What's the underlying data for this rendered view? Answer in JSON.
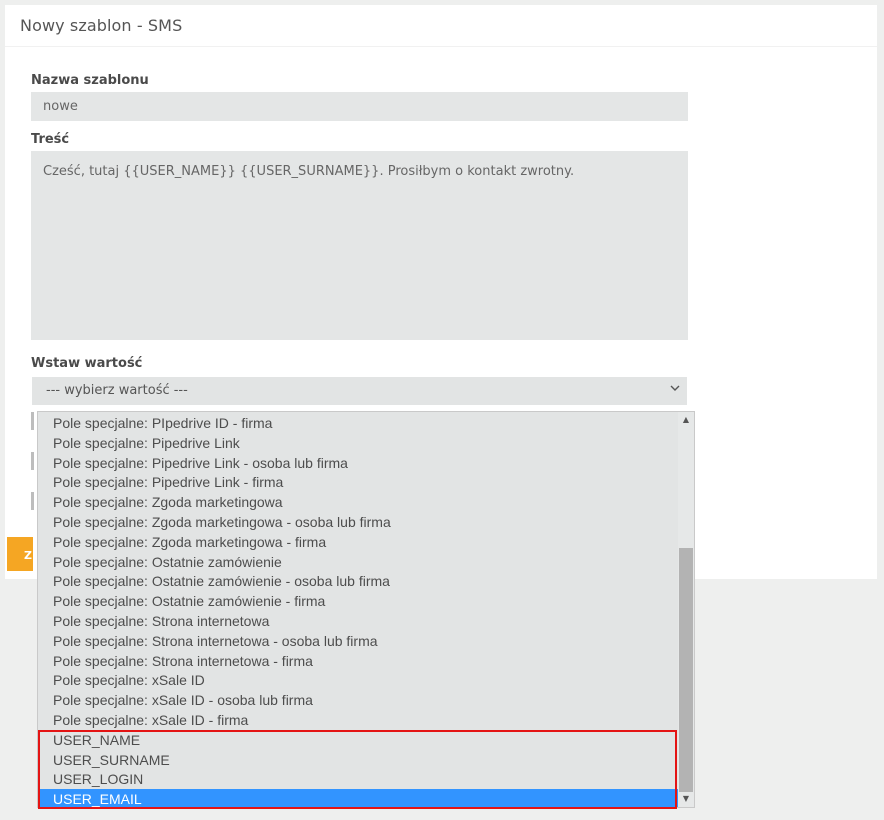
{
  "card": {
    "title": "Nowy szablon - SMS"
  },
  "form": {
    "name_label": "Nazwa szablonu",
    "name_value": "nowe",
    "content_label": "Treść",
    "content_value": "Cześć, tutaj {{USER_NAME}} {{USER_SURNAME}}. Prosiłbym o kontakt zwrotny.",
    "insert_label": "Wstaw wartość",
    "insert_selected": "--- wybierz wartość ---",
    "save_label_fragment": "Z"
  },
  "dropdown": {
    "options": [
      "Pole specjalne: PIpedrive ID - firma",
      "Pole specjalne: Pipedrive Link",
      "Pole specjalne: Pipedrive Link - osoba lub firma",
      "Pole specjalne: Pipedrive Link - firma",
      "Pole specjalne: Zgoda marketingowa",
      "Pole specjalne: Zgoda marketingowa - osoba lub firma",
      "Pole specjalne: Zgoda marketingowa - firma",
      "Pole specjalne: Ostatnie zamówienie",
      "Pole specjalne: Ostatnie zamówienie - osoba lub firma",
      "Pole specjalne: Ostatnie zamówienie - firma",
      "Pole specjalne: Strona internetowa",
      "Pole specjalne: Strona internetowa - osoba lub firma",
      "Pole specjalne: Strona internetowa - firma",
      "Pole specjalne: xSale ID",
      "Pole specjalne: xSale ID - osoba lub firma",
      "Pole specjalne: xSale ID - firma",
      "USER_NAME",
      "USER_SURNAME",
      "USER_LOGIN",
      "USER_EMAIL"
    ],
    "selected_index": 19,
    "scroll_up_icon": "▲",
    "scroll_down_icon": "▼"
  },
  "colors": {
    "accent": "#f5a623",
    "selected": "#3294ff",
    "highlight": "#e41414"
  }
}
